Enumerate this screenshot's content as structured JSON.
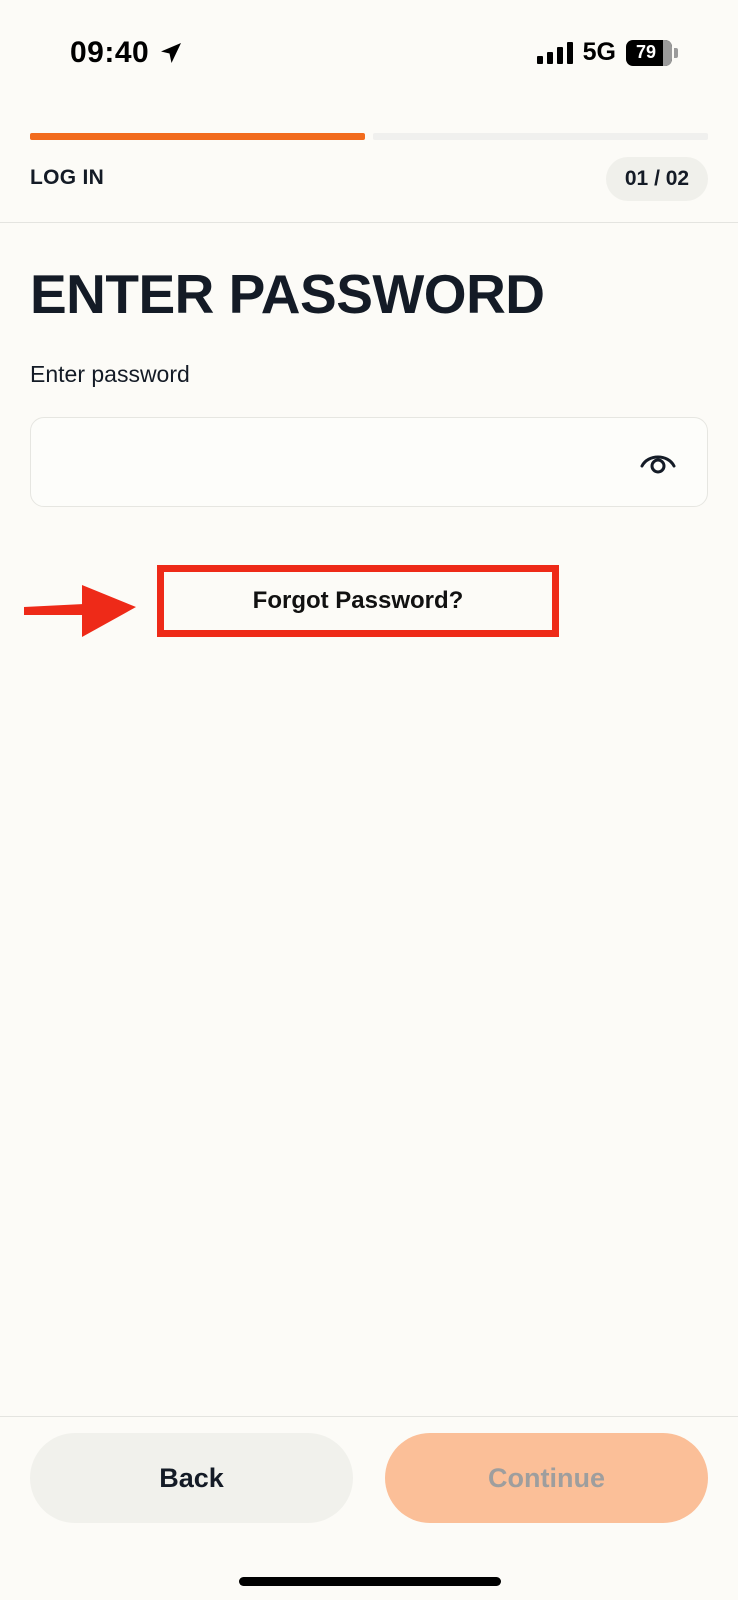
{
  "status_bar": {
    "time": "09:40",
    "network": "5G",
    "battery": "79",
    "location_icon": "location-arrow-icon",
    "signal_icon": "cellular-signal-icon"
  },
  "progress": {
    "current_step": 1,
    "total_steps": 2
  },
  "header": {
    "step_title": "LOG IN",
    "step_counter": "01 / 02"
  },
  "main": {
    "title": "ENTER PASSWORD",
    "password_label": "Enter password",
    "password_value": "",
    "reveal_icon": "eye-icon",
    "forgot_link": "Forgot Password?"
  },
  "footer": {
    "back_label": "Back",
    "continue_label": "Continue"
  },
  "colors": {
    "accent": "#f26b1d",
    "continue_disabled_bg": "#fbbf98",
    "annotation": "#ee2a18",
    "background": "#fcfbf7"
  }
}
